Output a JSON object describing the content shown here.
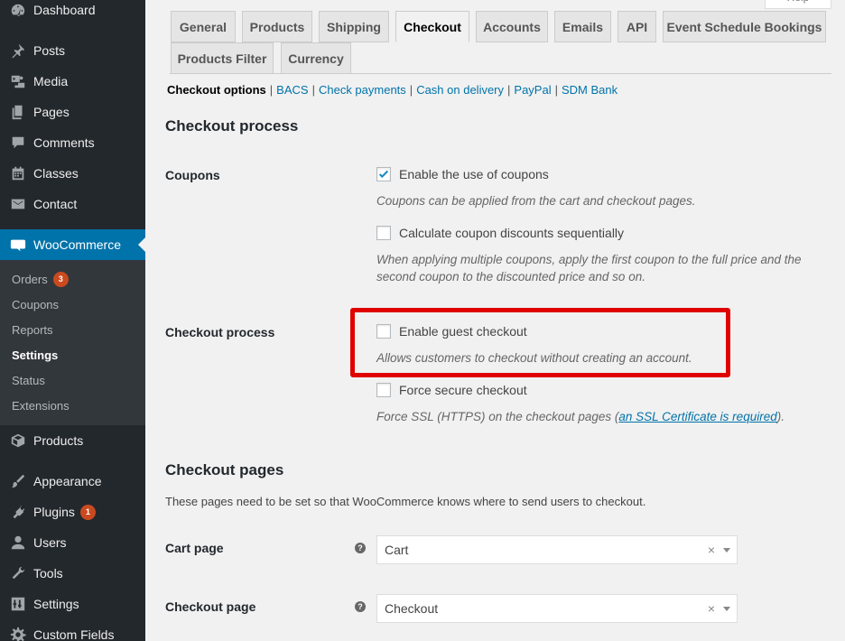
{
  "sidebar": {
    "items": [
      {
        "label": "Dashboard",
        "icon": "dashboard-icon"
      },
      {
        "label": "Posts",
        "icon": "pin-icon"
      },
      {
        "label": "Media",
        "icon": "media-icon"
      },
      {
        "label": "Pages",
        "icon": "pages-icon"
      },
      {
        "label": "Comments",
        "icon": "comments-icon"
      },
      {
        "label": "Classes",
        "icon": "calendar-icon"
      },
      {
        "label": "Contact",
        "icon": "mail-icon"
      },
      {
        "label": "WooCommerce",
        "icon": "woo-icon"
      },
      {
        "label": "Products",
        "icon": "products-icon"
      },
      {
        "label": "Appearance",
        "icon": "brush-icon"
      },
      {
        "label": "Plugins",
        "icon": "plugin-icon",
        "badge": "1"
      },
      {
        "label": "Users",
        "icon": "users-icon"
      },
      {
        "label": "Tools",
        "icon": "wrench-icon"
      },
      {
        "label": "Settings",
        "icon": "sliders-icon"
      },
      {
        "label": "Custom Fields",
        "icon": "gear-icon"
      }
    ],
    "submenu": [
      {
        "label": "Orders",
        "badge": "3"
      },
      {
        "label": "Coupons"
      },
      {
        "label": "Reports"
      },
      {
        "label": "Settings"
      },
      {
        "label": "Status"
      },
      {
        "label": "Extensions"
      }
    ]
  },
  "help_button": "Help",
  "tabs": [
    "General",
    "Products",
    "Shipping",
    "Checkout",
    "Accounts",
    "Emails",
    "API",
    "Event Schedule Bookings",
    "Products Filter",
    "Currency"
  ],
  "sublinks": [
    "Checkout options",
    "BACS",
    "Check payments",
    "Cash on delivery",
    "PayPal",
    "SDM Bank"
  ],
  "checkout_process": {
    "heading": "Checkout process",
    "coupons_label": "Coupons",
    "enable_coupons": "Enable the use of coupons",
    "enable_coupons_desc": "Coupons can be applied from the cart and checkout pages.",
    "sequential": "Calculate coupon discounts sequentially",
    "sequential_desc_1": "When applying multiple coupons, apply the first coupon to the full price and the",
    "sequential_desc_2": "second coupon to the discounted price and so on.",
    "process_label": "Checkout process",
    "guest": "Enable guest checkout",
    "guest_desc": "Allows customers to checkout without creating an account.",
    "secure": "Force secure checkout",
    "secure_desc_pre": "Force SSL (HTTPS) on the checkout pages (",
    "secure_desc_link": "an SSL Certificate is required",
    "secure_desc_post": ")."
  },
  "checkout_pages": {
    "heading": "Checkout pages",
    "desc": "These pages need to be set so that WooCommerce knows where to send users to checkout.",
    "cart_label": "Cart page",
    "cart_value": "Cart",
    "checkout_label": "Checkout page",
    "checkout_value": "Checkout",
    "help_glyph": "?",
    "clear_glyph": "×"
  },
  "colors": {
    "sidebar_bg": "#23282d",
    "accent": "#0073aa",
    "highlight": "#e00000",
    "badge": "#ca4a1f"
  }
}
